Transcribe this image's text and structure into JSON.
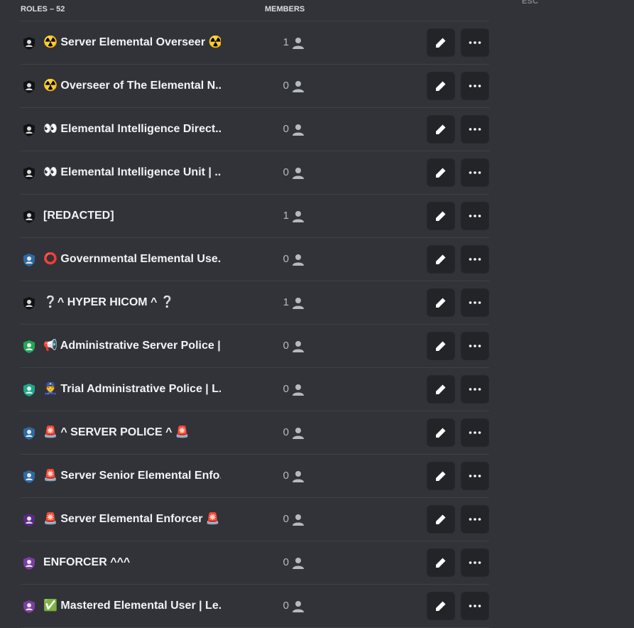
{
  "esc_label": "ESC",
  "header": {
    "roles_label": "ROLES – 52",
    "members_label": "MEMBERS"
  },
  "colors": {
    "black": "#111214",
    "blue": "#2e6aa3",
    "green": "#23a55a",
    "teal": "#1fa88a",
    "purple": "#7b3fa0"
  },
  "roles": [
    {
      "name": "☢️ Server Elemental Overseer ☢️",
      "members": "1",
      "color": "#111214"
    },
    {
      "name": "☢️ Overseer of The Elemental N...",
      "members": "0",
      "color": "#111214"
    },
    {
      "name": "👀 Elemental Intelligence Direct...",
      "members": "0",
      "color": "#111214"
    },
    {
      "name": "👀 Elemental Intelligence Unit | ...",
      "members": "0",
      "color": "#111214"
    },
    {
      "name": "[REDACTED]",
      "members": "1",
      "color": "#111214"
    },
    {
      "name": "⭕ Governmental Elemental Use...",
      "members": "0",
      "color": "#2e6aa3"
    },
    {
      "name": "❔^ HYPER HICOM ^ ❔",
      "members": "1",
      "color": "#111214"
    },
    {
      "name": "📢 Administrative Server Police |...",
      "members": "0",
      "color": "#23a55a"
    },
    {
      "name": "👮 Trial Administrative Police | L...",
      "members": "0",
      "color": "#1fa88a"
    },
    {
      "name": "🚨 ^ SERVER POLICE ^ 🚨",
      "members": "0",
      "color": "#2e6aa3"
    },
    {
      "name": "🚨 Server Senior Elemental Enfo...",
      "members": "0",
      "color": "#2e6aa3"
    },
    {
      "name": "🚨 Server Elemental Enforcer 🚨",
      "members": "0",
      "color": "#5a2a82"
    },
    {
      "name": "ENFORCER ^^^",
      "members": "0",
      "color": "#7b3fa0"
    },
    {
      "name": "✅ Mastered Elemental User | Le...",
      "members": "0",
      "color": "#7b3fa0"
    }
  ]
}
